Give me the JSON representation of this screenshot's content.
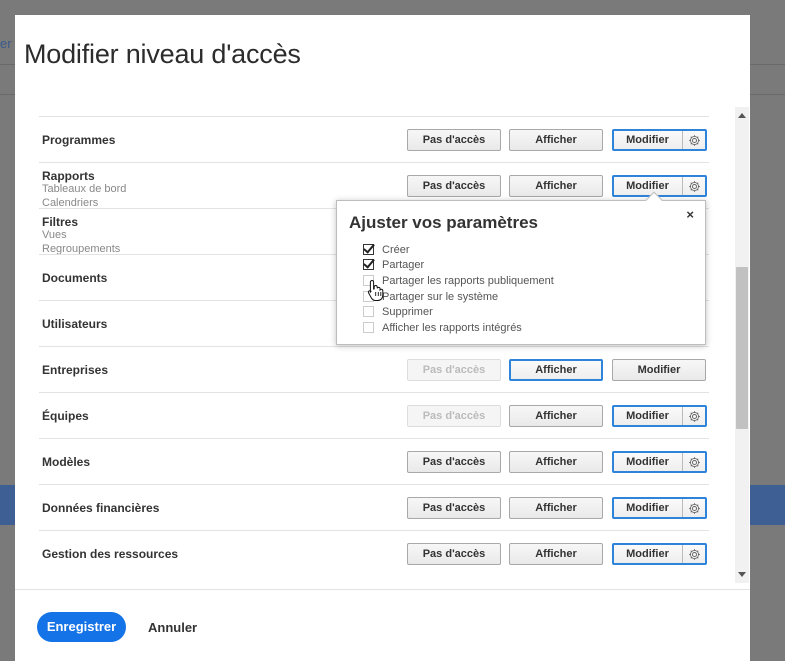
{
  "background": {
    "top_link": "er"
  },
  "dialog": {
    "title": "Modifier niveau d'accès",
    "rows": [
      {
        "label": "Programmes",
        "sublabels": [],
        "buttons": {
          "no_access": "Pas d'accès",
          "view": "Afficher",
          "edit": "Modifier"
        }
      },
      {
        "label": "Rapports",
        "sublabels": [
          "Tableaux de bord",
          "Calendriers"
        ],
        "buttons": {
          "no_access": "Pas d'accès",
          "view": "Afficher",
          "edit": "Modifier"
        }
      },
      {
        "label": "Filtres",
        "sublabels": [
          "Vues",
          "Regroupements"
        ]
      },
      {
        "label": "Documents",
        "sublabels": []
      },
      {
        "label": "Utilisateurs",
        "sublabels": []
      },
      {
        "label": "Entreprises",
        "sublabels": [],
        "buttons": {
          "no_access": "Pas d'accès",
          "view": "Afficher",
          "edit": "Modifier"
        }
      },
      {
        "label": "Équipes",
        "sublabels": [],
        "buttons": {
          "no_access": "Pas d'accès",
          "view": "Afficher",
          "edit": "Modifier"
        }
      },
      {
        "label": "Modèles",
        "sublabels": [],
        "buttons": {
          "no_access": "Pas d'accès",
          "view": "Afficher",
          "edit": "Modifier"
        }
      },
      {
        "label": "Données financières",
        "sublabels": [],
        "buttons": {
          "no_access": "Pas d'accès",
          "view": "Afficher",
          "edit": "Modifier"
        }
      },
      {
        "label": "Gestion des ressources",
        "sublabels": [],
        "buttons": {
          "no_access": "Pas d'accès",
          "view": "Afficher",
          "edit": "Modifier"
        }
      }
    ],
    "footer": {
      "save": "Enregistrer",
      "cancel": "Annuler"
    }
  },
  "popover": {
    "title": "Ajuster vos paramètres",
    "close": "×",
    "options": [
      {
        "label": "Créer",
        "checked": true
      },
      {
        "label": "Partager",
        "checked": true
      },
      {
        "label": "Partager les rapports publiquement",
        "checked": false
      },
      {
        "label": "Partager sur le système",
        "checked": false
      },
      {
        "label": "Supprimer",
        "checked": false
      },
      {
        "label": "Afficher les rapports intégrés",
        "checked": false
      }
    ]
  },
  "colors": {
    "accent": "#1473e6",
    "selected_border": "#2d84d9",
    "background_band": "#3e5f93"
  },
  "icons": {
    "settings": "gear-icon",
    "close": "close-icon",
    "cursor": "hand-pointer-icon"
  }
}
